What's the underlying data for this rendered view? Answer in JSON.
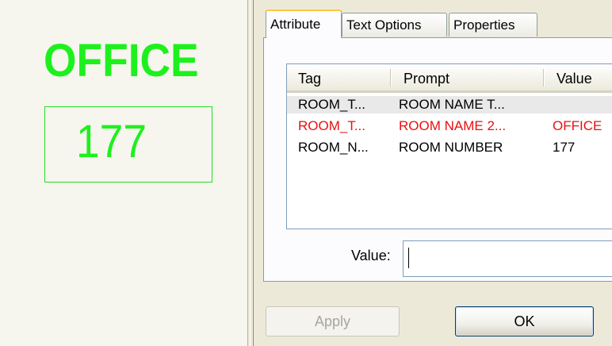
{
  "drawing": {
    "room_name_text": "OFFICE",
    "room_number_text": "177"
  },
  "dialog": {
    "tabs": [
      {
        "label": "Attribute",
        "active": true
      },
      {
        "label": "Text Options",
        "active": false
      },
      {
        "label": "Properties",
        "active": false
      }
    ],
    "table": {
      "columns": [
        "Tag",
        "Prompt",
        "Value"
      ],
      "rows": [
        {
          "tag": "ROOM_T...",
          "prompt": "ROOM NAME T...",
          "value": "",
          "selected": true,
          "color": "#000000"
        },
        {
          "tag": "ROOM_T...",
          "prompt": "ROOM NAME 2...",
          "value": "OFFICE",
          "selected": false,
          "color": "#e81010"
        },
        {
          "tag": "ROOM_N...",
          "prompt": "ROOM NUMBER",
          "value": "177",
          "selected": false,
          "color": "#000000"
        }
      ]
    },
    "value_field": {
      "label": "Value:",
      "value": ""
    },
    "buttons": {
      "apply": "Apply",
      "ok": "OK"
    }
  },
  "colors": {
    "drawing_text": "#1ef01e",
    "highlight_row_text": "#e81010"
  }
}
